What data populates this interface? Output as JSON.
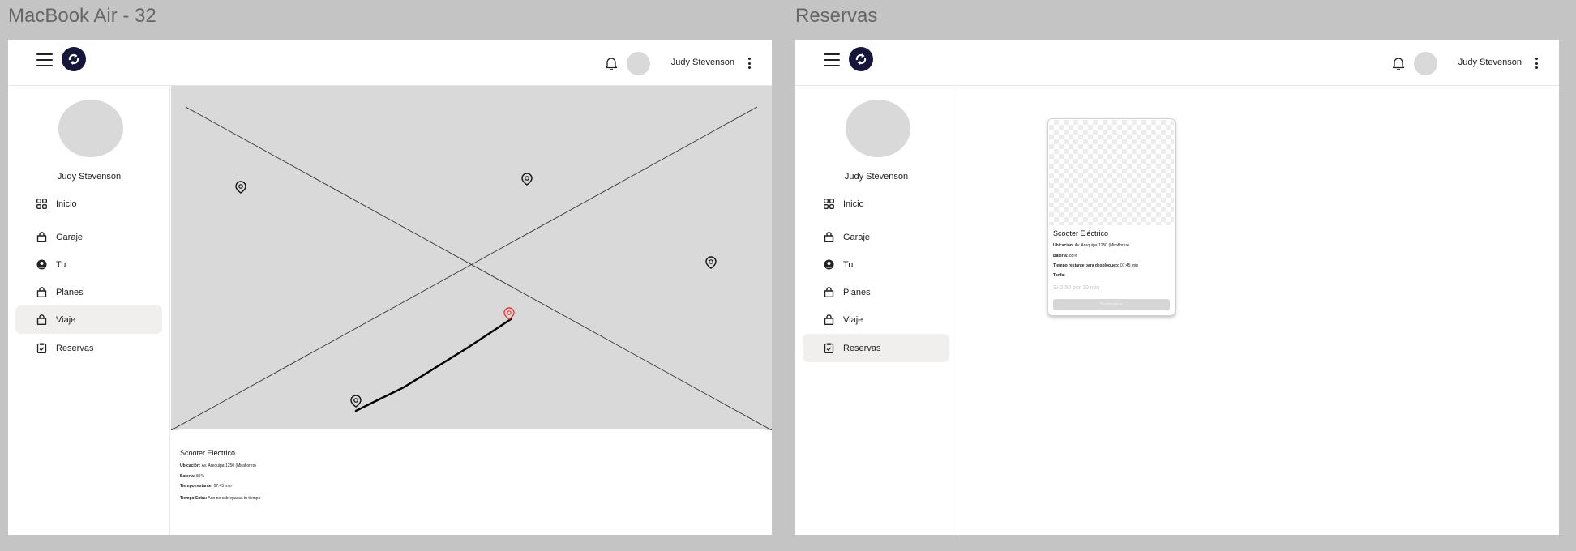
{
  "frames": [
    {
      "label": "MacBook Air - 32",
      "topbar": {
        "user_name": "Judy Stevenson"
      },
      "sidebar": {
        "user_name": "Judy Stevenson",
        "items": [
          {
            "label": "Inicio",
            "icon": "grid-icon"
          },
          {
            "label": "Garaje",
            "icon": "bag-icon"
          },
          {
            "label": "Tu",
            "icon": "user-circle-icon"
          },
          {
            "label": "Planes",
            "icon": "bag-icon"
          },
          {
            "label": "Viaje",
            "icon": "bag-icon"
          },
          {
            "label": "Reservas",
            "icon": "clipboard-check-icon"
          }
        ],
        "active": "Viaje"
      },
      "trip_panel": {
        "title": "Scooter Eléctrico",
        "ubicacion_label": "Ubicación:",
        "ubicacion_value": " Av. Arequipa 1250 (Miraflores)",
        "bateria_label": "Batería:",
        "bateria_value": " 85%",
        "tiempo_label": "Tiempo restante:",
        "tiempo_value": " 07:45 min",
        "extra_label": "Tiempo Extra:",
        "extra_value": " Aun no sobrepasas tu tiempo"
      }
    },
    {
      "label": "Reservas",
      "topbar": {
        "user_name": "Judy Stevenson"
      },
      "sidebar": {
        "user_name": "Judy Stevenson",
        "items": [
          {
            "label": "Inicio",
            "icon": "grid-icon"
          },
          {
            "label": "Garaje",
            "icon": "bag-icon"
          },
          {
            "label": "Tu",
            "icon": "user-circle-icon"
          },
          {
            "label": "Planes",
            "icon": "bag-icon"
          },
          {
            "label": "Viaje",
            "icon": "bag-icon"
          },
          {
            "label": "Reservas",
            "icon": "clipboard-check-icon"
          }
        ],
        "active": "Reservas"
      },
      "reservation_card": {
        "title": "Scooter Eléctrico",
        "ubicacion_label": "Ubicación:",
        "ubicacion_value": "  Av. Arequipa 1250 (Miraflores)",
        "bateria_label": "Batería:",
        "bateria_value": " 85%",
        "tiempo_label": "Tiempo restante para desbloqueo:",
        "tiempo_value": " 07:45 min",
        "tarifa_label": "Tarifa:",
        "price": "S/ 2.50 por 30 min",
        "button_label": "Desbloquear"
      }
    }
  ],
  "colors": {
    "logo_bg": "#16163a",
    "active_pin": "#e53935",
    "map_bg": "#d9d9d9",
    "active_nav": "#f0efed"
  }
}
